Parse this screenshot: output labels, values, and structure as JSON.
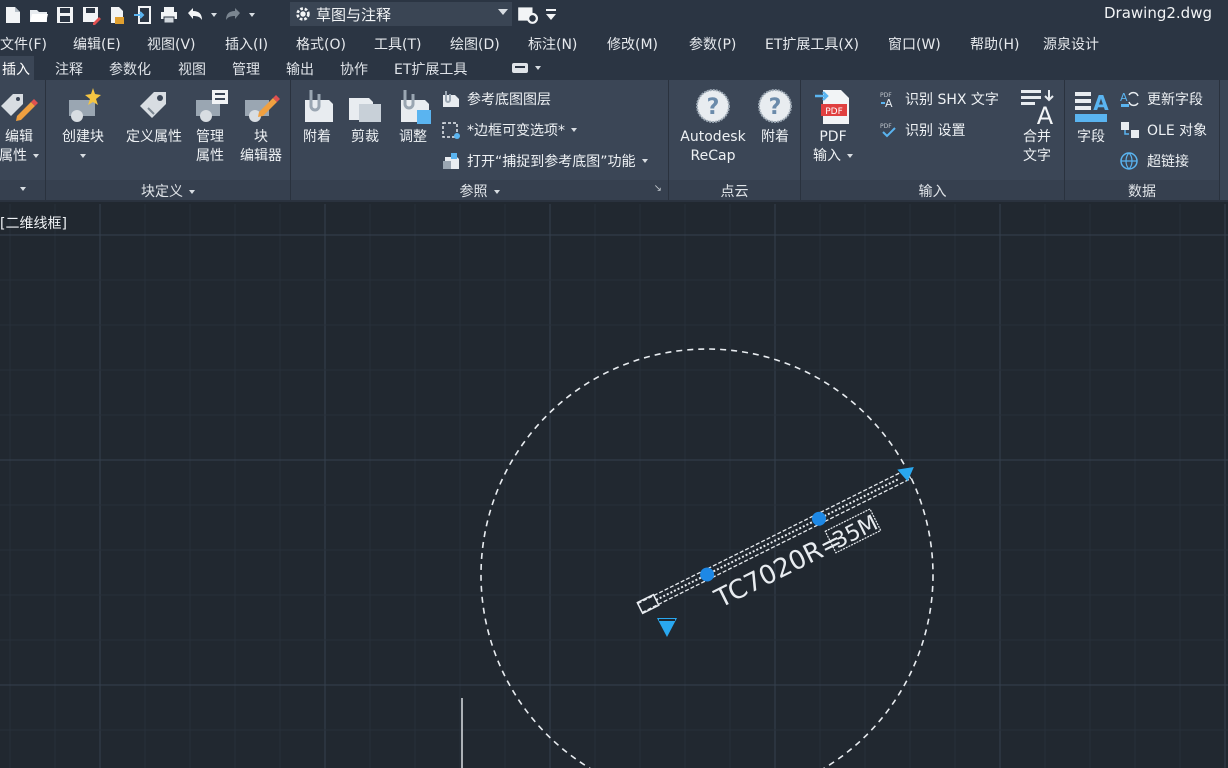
{
  "window": {
    "title": "Drawing2.dwg"
  },
  "quick_access": {
    "workspace": "草图与注释"
  },
  "menubar": [
    "文件(F)",
    "编辑(E)",
    "视图(V)",
    "插入(I)",
    "格式(O)",
    "工具(T)",
    "绘图(D)",
    "标注(N)",
    "修改(M)",
    "参数(P)",
    "ET扩展工具(X)",
    "窗口(W)",
    "帮助(H)",
    "源泉设计"
  ],
  "tabs": [
    "插入",
    "注释",
    "参数化",
    "视图",
    "管理",
    "输出",
    "协作",
    "ET扩展工具"
  ],
  "ribbon": {
    "panel_block_edit": {
      "btn1_l1": "编辑",
      "btn1_l2": "属性"
    },
    "panel_block_def": {
      "title": "块定义",
      "create_block": "创建块",
      "define_attr": "定义属性",
      "manage_attr_l1": "管理",
      "manage_attr_l2": "属性",
      "block_editor_l1": "块",
      "block_editor_l2": "编辑器"
    },
    "panel_reference": {
      "title": "参照",
      "attach": "附着",
      "clip": "剪裁",
      "adjust": "调整",
      "underlay_layers": "参考底图图层",
      "frame_variable": "*边框可变选项*",
      "snap_underlay": "打开“捕捉到参考底图”功能"
    },
    "panel_pointcloud": {
      "title": "点云",
      "recap_l1": "Autodesk",
      "recap_l2": "ReCap",
      "attach": "附着"
    },
    "panel_import": {
      "title": "输入",
      "pdf_l1": "PDF",
      "pdf_l2": "输入",
      "recognize_shx": "识别 SHX 文字",
      "recognize_settings": "识别 设置",
      "merge_text_l1": "合并",
      "merge_text_l2": "文字"
    },
    "panel_data": {
      "title": "数据",
      "field": "字段",
      "update_fields": "更新字段",
      "ole_object": "OLE 对象",
      "hyperlink": "超链接"
    }
  },
  "viewport": {
    "label": "[二维线框]"
  },
  "drawing": {
    "text_label": "TC7020R=",
    "text_box": "35M"
  },
  "colors": {
    "background": "#212830",
    "grip": "#1e88e5",
    "line": "#e8ecf0"
  }
}
